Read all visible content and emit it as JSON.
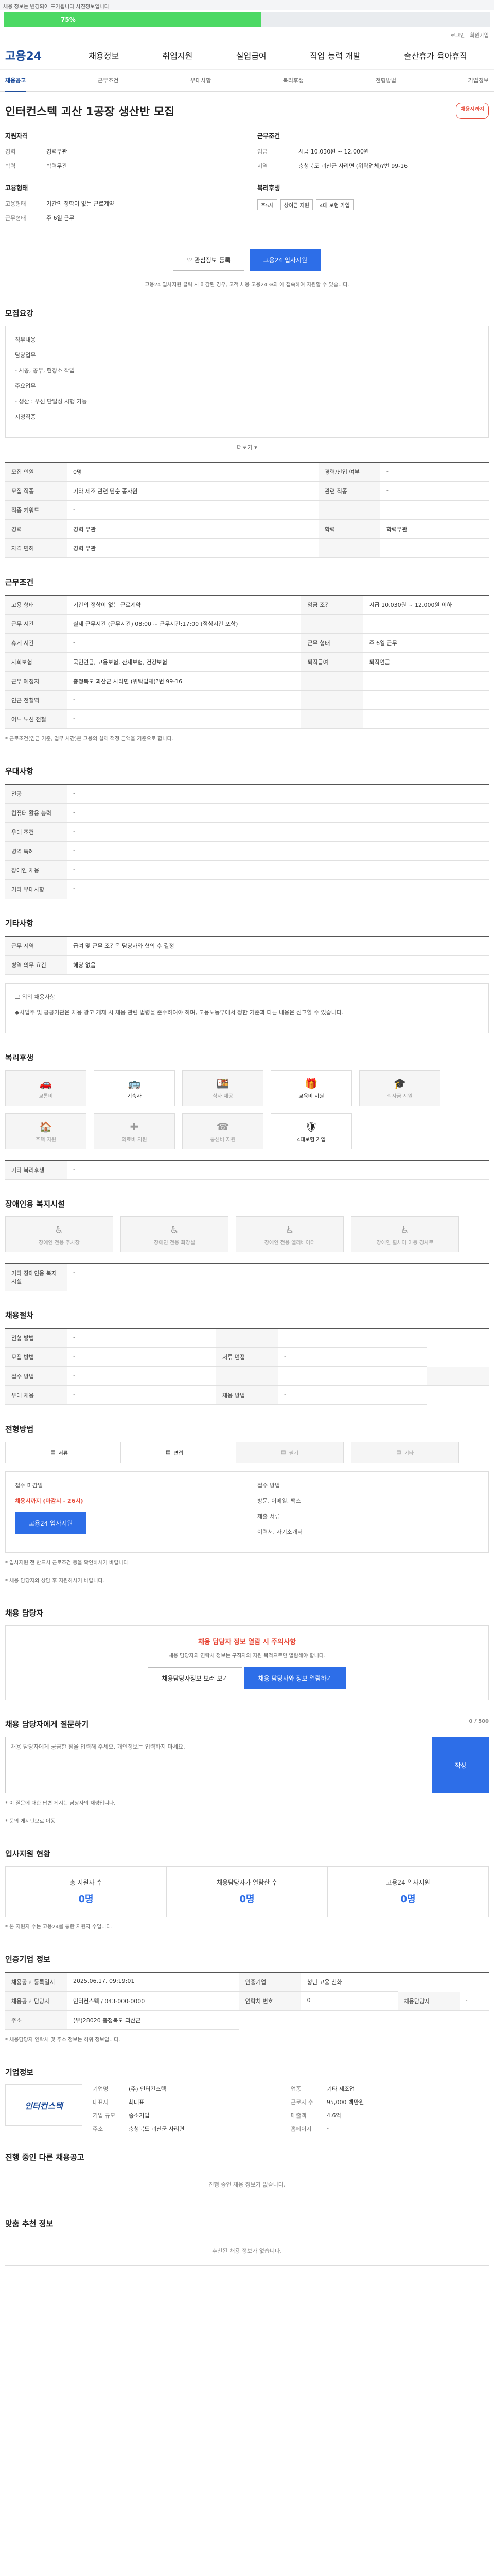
{
  "topbar": {
    "notice": "채용 정보는 변경되어 표기됩니다 사진정보입니다"
  },
  "progress": {
    "percent": "75%",
    "fraction": 0.53
  },
  "util": {
    "links": [
      "로그인",
      "회원가입"
    ]
  },
  "header": {
    "logo": "고용24",
    "menu": [
      "채용정보",
      "취업지원",
      "실업급여",
      "직업 능력 개발",
      "출산휴가 육아휴직"
    ]
  },
  "tabs": [
    "채용공고",
    "근무조건",
    "우대사항",
    "복리후생",
    "전형방법",
    "기업정보"
  ],
  "job": {
    "title": "인터컨스텍 괴산 1공장 생산반 모집",
    "badge": "채용시까지",
    "company_label": "지원자격",
    "career_k": "경력",
    "career_v": "경력무관",
    "edu_k": "학력",
    "edu_v": "학력무관",
    "emp_label": "고용형태",
    "emp_k": "고용형태",
    "emp_v": "기간의 정함이 없는 근로계약",
    "emp2_k": "근무형태",
    "emp2_v": "주 6일 근무",
    "cond_label": "근무조건",
    "pay_k": "임금",
    "pay_v": "시급 10,030원 ~ 12,000원",
    "loc_k": "지역",
    "loc_v": "충청북도 괴산군 사리면 (위탁업체)?번 99-16",
    "welfare_label": "복리후생",
    "welfare_chips": [
      "주5시",
      "상여금 지원",
      "4대 보험 가입"
    ],
    "save_btn": "관심정보 등록",
    "apply_btn": "고용24 입사지원",
    "apply_note": "고용24 입사지원 클릭 시 마감된 경우, 고객 채용 고용24 ※의 에 접속하여 지원할 수 있습니다."
  },
  "recruit": {
    "title": "모집요강",
    "box_title": "직무내용",
    "lines": [
      "담당업무",
      "- 시공, 공무, 현장소 작업",
      "주요업무",
      "- 생산 : 우선 단일성 시행 가능"
    ],
    "detail": "지정직종",
    "more": "더보기",
    "rows": [
      [
        "모집 인원",
        "0명",
        "경력/신입 여부",
        "-"
      ],
      [
        "모집 직종",
        "기타 제조 관련 단순 종사원",
        "관련 직종",
        "-"
      ],
      [
        "직종 키워드",
        "-",
        "",
        ""
      ],
      [
        "경력",
        "경력 무관",
        "학력",
        "학력무관"
      ],
      [
        "자격 면허",
        "경력 무관",
        "",
        ""
      ]
    ]
  },
  "work": {
    "title": "근무조건",
    "rows": [
      [
        "고용 형태",
        "기간의 정함이 없는 근로계약",
        "임금 조건",
        "시급 10,030원 ~ 12,000원 이하"
      ],
      [
        "근무 시간",
        "실제 근무시간 (근무시간) 08:00 ~ 근무시간:17:00 (점심시간 포함)",
        "",
        ""
      ],
      [
        "휴게 시간",
        "-",
        "근무 형태",
        "주 6일 근무"
      ],
      [
        "사회보험",
        "국민연금, 고용보험, 산재보험, 건강보험",
        "퇴직급여",
        "퇴직연금"
      ],
      [
        "근무 예정지",
        "충청북도 괴산군 사리면 (위탁업체)?번 99-16",
        "",
        ""
      ],
      [
        "인근 전철역",
        "-",
        "",
        ""
      ],
      [
        "어느 노선 전철",
        "-",
        "",
        ""
      ]
    ],
    "note": "* 근로조건(임금 기준, 업무 시간)은 고용의 실제 적정 금액을 기준으로 합니다."
  },
  "pref": {
    "title": "우대사항",
    "rows": [
      [
        "전공",
        "-"
      ],
      [
        "컴퓨터 활용 능력",
        "-"
      ],
      [
        "우대 조건",
        "-"
      ],
      [
        "병역 특례",
        "-"
      ],
      [
        "장애인 채용",
        "-"
      ],
      [
        "기타 우대사항",
        "-"
      ]
    ]
  },
  "other": {
    "title": "기타사항",
    "rows": [
      [
        "근무 지역",
        "급여 및 근무 조건은 담당자와 협의 후 결정"
      ],
      [
        "병역 의무 요건",
        "해당 없음"
      ]
    ],
    "box": "그 외의 채용사항",
    "box_text": "◆사업주 및 공공기관은 채용 광고 게재 시 채용 관련 법령을 준수하여야 하며, 고용노동부에서 정한 기준과 다른 내용은 신고할 수 있습니다."
  },
  "welfare": {
    "title": "복리후생",
    "items": [
      {
        "icon": "car-icon",
        "label": "교통비",
        "on": false
      },
      {
        "icon": "bus-icon",
        "label": "기숙사",
        "on": true
      },
      {
        "icon": "meal-icon",
        "label": "식사 제공",
        "on": false
      },
      {
        "icon": "gift-icon",
        "label": "교육비 지원",
        "on": true
      },
      {
        "icon": "graduation-icon",
        "label": "학자금 지원",
        "on": false
      },
      {
        "icon": "house-icon",
        "label": "주택 지원",
        "on": false
      },
      {
        "icon": "medical-icon",
        "label": "의료비 지원",
        "on": false
      },
      {
        "icon": "phone-icon",
        "label": "통신비 지원",
        "on": false
      },
      {
        "icon": "insurance-icon",
        "label": "4대보험 가입",
        "on": true
      }
    ],
    "other_title": "기타 복리후생",
    "other_val": "-"
  },
  "disability": {
    "title": "장애인용 복지시설",
    "items": [
      "장애인 전용 주차장",
      "장애인 전용 화장실",
      "장애인 전용 엘리베이터",
      "장애인 휠체어 이동 경사로"
    ],
    "other_title": "기타 장애인용 복지시설",
    "other_val": "-"
  },
  "process": {
    "title": "채용절차",
    "rows": [
      [
        "전형 방법",
        "-",
        "",
        ""
      ],
      [
        "모집 방법",
        "-",
        "서류 면접",
        "-"
      ],
      [
        "접수 방법",
        "-",
        "",
        "",
        ""
      ],
      [
        "우대 채용",
        "-",
        "채용 방법",
        "-"
      ]
    ]
  },
  "apply": {
    "title": "전형방법",
    "methods": [
      "서류",
      "면접",
      "필기",
      "기타"
    ],
    "on": [
      true,
      true,
      false,
      false
    ],
    "deadline_k": "접수 마감일",
    "deadline_v": "채용시까지 (마감시 - 26시)",
    "apply_btn": "고용24 입사지원",
    "method_k": "접수 방법",
    "method_v": "방문, 이메일, 팩스",
    "doc_k": "제출 서류",
    "doc_v": "이력서, 자기소개서",
    "notes": [
      "* 입사지원 전 반드시 근로조건 등을 확인하시기 바랍니다.",
      "* 채용 담당자와 상담 후 지원하시기 바랍니다."
    ]
  },
  "contact": {
    "title": "채용 담당자",
    "warn": "채용 담당자 정보 열람 시 주의사항",
    "sub": "채용 담당자의 연락처 정보는 구직자의 지원 목적으로만 열람해야 합니다.",
    "btn1": "채용담당자정보 보러 보기",
    "btn2": "채용 담당자와 정보 열람하기"
  },
  "qa": {
    "title": "채용 담당자에게 질문하기",
    "counter": "0 / 500",
    "placeholder": "채용 담당자에게 궁금한 점을 입력해 주세요. 개인정보는 입력하지 마세요.",
    "btn": "작성",
    "notes": [
      "* 이 질문에 대한 답변 게시는 담당자의 재량입니다.",
      "* 문의 게시판으로 이동"
    ]
  },
  "stats": {
    "title": "입사지원 현황",
    "items": [
      [
        "총 지원자 수",
        "0명"
      ],
      [
        "채용담당자가 열람한 수",
        "0명"
      ],
      [
        "고용24 입사지원",
        "0명"
      ]
    ],
    "note": "* 본 지원자 수는 고용24를 통한 지원자 수입니다."
  },
  "info": {
    "title": "인증기업 정보",
    "rows": [
      [
        "채용공고 등록일시",
        "2025.06.17. 09:19:01",
        "인증기업",
        "청년 고용 친화"
      ],
      [
        "채용공고 담당자",
        "인터컨스텍 / 043-000-0000",
        "연락처 번호",
        "0",
        "채용담당자",
        "-"
      ],
      [
        "주소",
        "(우)28020 충청북도 괴산군"
      ]
    ],
    "note": "* 채용담당자 연락처 및 주소 정보는 허위 정보입니다."
  },
  "company": {
    "title": "기업정보",
    "logo": "인터컨스텍",
    "rows": [
      [
        "기업명",
        "(주) 인터컨스텍",
        "업종",
        "기타 제조업"
      ],
      [
        "대표자",
        "최대표",
        "근로자 수",
        "95,000 백만원"
      ],
      [
        "기업 규모",
        "중소기업",
        "매출액",
        "4.6억"
      ],
      [
        "주소",
        "충청북도 괴산군 사리면",
        "홈페이지",
        "-"
      ]
    ]
  },
  "related": {
    "title": "진행 중인 다른 채용공고",
    "empty": "진행 중인 채용 정보가 없습니다."
  },
  "recommend": {
    "title": "맞춤 추천 정보",
    "empty": "추천된 채용 정보가 없습니다."
  }
}
